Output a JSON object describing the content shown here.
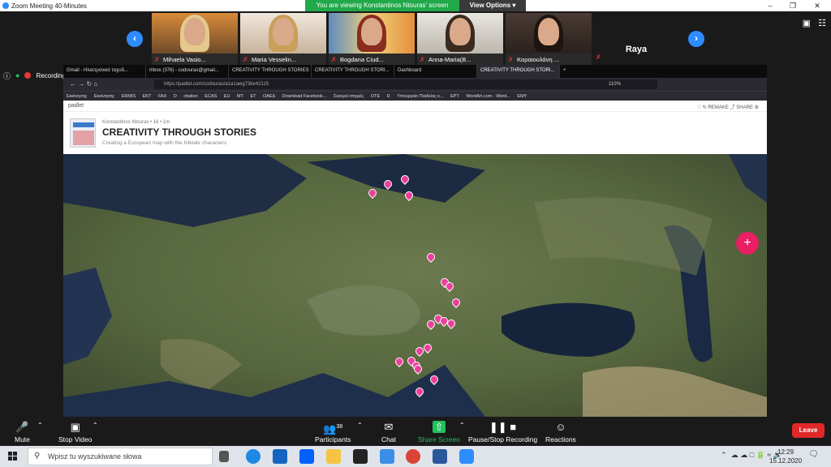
{
  "window": {
    "title": "Zoom Meeting 40-Minutes",
    "controls": [
      "–",
      "❐",
      "✕"
    ]
  },
  "banner": {
    "viewing": "You are viewing Konstantinos Ntouras' screen",
    "options": "View Options ▾"
  },
  "gallery": {
    "participants": [
      {
        "name": "Mihaela Vasio..."
      },
      {
        "name": "Maria Vesselin..."
      },
      {
        "name": "Bogdana Ciud..."
      },
      {
        "name": "Anna-Maria(B..."
      },
      {
        "name": "Καραιουλάνη ..."
      }
    ],
    "raya": "Raya",
    "prev": "‹",
    "next": "›"
  },
  "recording": {
    "label": "Recording..."
  },
  "browser": {
    "tabs": [
      {
        "label": "Gmail - Ηλεκτρονικό ταχυδ..."
      },
      {
        "label": "Inbox (376) - codouras@gmail..."
      },
      {
        "label": "CREATIVITY THROUGH STORIES"
      },
      {
        "label": "CREATIVITY THROUGH STORI..."
      },
      {
        "label": "Dashboard"
      },
      {
        "label": "CREATIVITY THROUGH STORI..."
      }
    ],
    "url": "https://padlet.com/codouras/a1a1awg73ke421z5",
    "zoom": "110%",
    "bookmarks": [
      "Εκκίνησης",
      "Εκκίνησης",
      "ERMIS",
      "EKT",
      "FAX",
      "D",
      "citation",
      "ECAS",
      "EU",
      "MT",
      "ET",
      "ΟΑΕΔ",
      "Download Facebook...",
      "Σεισμοί στιγμές",
      "OTE",
      "D",
      "Υπουργείο Παιδείας κ...",
      "EPT",
      "WordArt.com - Word...",
      "EMY"
    ]
  },
  "padlet": {
    "brand": "padlet",
    "actions": "♡   ↻ REMAKE   ⤴ SHARE   ⚙",
    "author": "Konstantinos Ntouras  •  16  •  1m",
    "title": "CREATIVITY THROUGH STORIES",
    "subtitle": "Creating a European map with the folktale characters",
    "add": "+"
  },
  "toolbar": {
    "mute": "Mute",
    "stop_video": "Stop Video",
    "participants": "Participants",
    "participant_count": "38",
    "chat": "Chat",
    "share_screen": "Share Screen",
    "pause_recording": "Pause/Stop Recording",
    "reactions": "Reactions",
    "leave": "Leave"
  },
  "taskbar": {
    "search_placeholder": "Wpisz tu wyszukiwane słowa",
    "time": "12:29",
    "date": "15.12.2020"
  }
}
